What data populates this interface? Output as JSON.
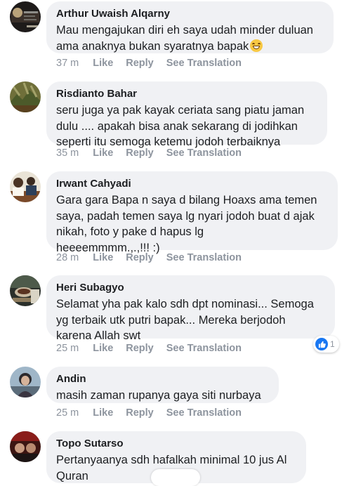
{
  "actions": {
    "like": "Like",
    "reply": "Reply",
    "see_translation": "See Translation"
  },
  "comments": [
    {
      "author": "Arthur Uwaish Alqarny",
      "lines": [
        "Mau mengajukan diri eh saya udah minder duluan",
        "ama anaknya  bukan syaratnya bapak"
      ],
      "time": "37 m",
      "emoji": "grinning-face-icon"
    },
    {
      "author": "Risdianto Bahar",
      "lines": [
        "seru juga ya pak kayak ceriata  sang piatu jaman",
        "dulu  .... apakah bisa anak sekarang di jodihkan",
        "seperti itu semoga ketemu jodoh terbaiknya"
      ],
      "time": "35 m"
    },
    {
      "author": "Irwant Cahyadi",
      "lines": [
        "Gara gara Bapa n saya d bilang Hoaxs ama temen",
        "saya,  padah temen saya lg nyari jodoh buat d ajak",
        "nikah,  foto y pake d hapus lg",
        "heeeemmmm.,.,!!!  :)"
      ],
      "time": "28 m"
    },
    {
      "author": "Heri Subagyo",
      "lines": [
        "Selamat yha pak kalo sdh dpt nominasi... Semoga",
        "yg terbaik utk putri bapak... Mereka berjodoh",
        "karena Allah swt"
      ],
      "time": "25 m",
      "reaction_count": "1"
    },
    {
      "author": "Andin",
      "lines": [
        "masih zaman rupanya gaya siti nurbaya"
      ],
      "time": "25 m"
    },
    {
      "author": "Topo Sutarso",
      "lines": [
        "Pertanyaanya sdh hafalkah minimal 10 jus Al",
        "Quran"
      ]
    }
  ],
  "colors": {
    "bubble": "#f0f1f4",
    "meta": "#8d949e",
    "like_blue": "#1877f2"
  }
}
